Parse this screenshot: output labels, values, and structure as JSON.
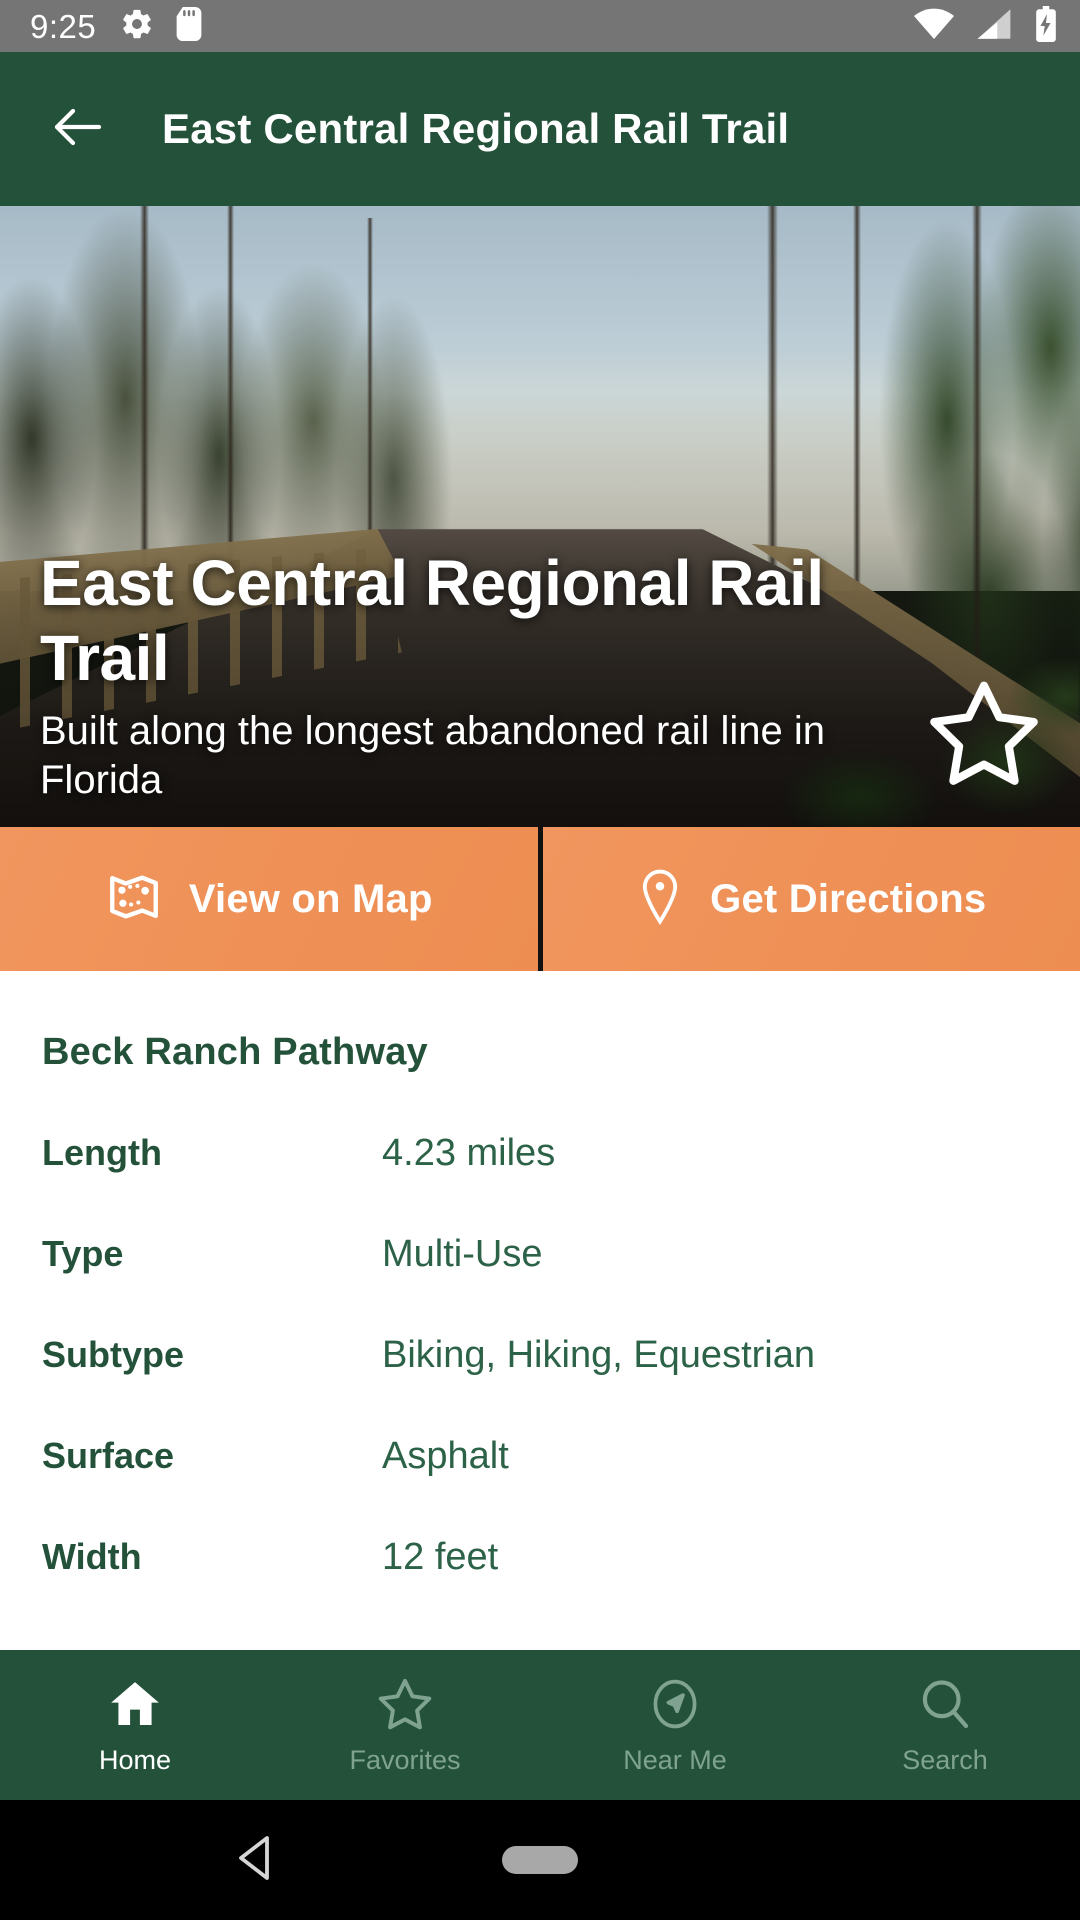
{
  "status_bar": {
    "time": "9:25",
    "left_icons": [
      "gear-icon",
      "sd-card-icon"
    ],
    "right_icons": [
      "wifi-icon",
      "cellular-signal-icon",
      "battery-charging-icon"
    ],
    "background_color": "#757575"
  },
  "app_bar": {
    "back_icon": "arrow-left-icon",
    "title": "East Central Regional Rail Trail",
    "background_color": "#235139",
    "text_color": "#ffffff"
  },
  "hero": {
    "title": "East Central Regional Rail Trail",
    "subtitle": "Built along the longest abandoned rail line in Florida",
    "favorite_icon": "star-outline-icon",
    "favorite_active": false,
    "image_description": "Wooden boardwalk trail through Florida pine forest"
  },
  "actions": {
    "background_color": "#ef9258",
    "buttons": [
      {
        "label": "View on Map",
        "icon": "map-icon"
      },
      {
        "label": "Get Directions",
        "icon": "map-pin-icon"
      }
    ]
  },
  "details": {
    "section_title": "Beck Ranch Pathway",
    "accent_color": "#235139",
    "specs": [
      {
        "key": "Length",
        "value": "4.23 miles"
      },
      {
        "key": "Type",
        "value": "Multi-Use"
      },
      {
        "key": "Subtype",
        "value": "Biking, Hiking, Equestrian"
      },
      {
        "key": "Surface",
        "value": "Asphalt"
      },
      {
        "key": "Width",
        "value": "12 feet"
      }
    ]
  },
  "bottom_nav": {
    "background_color": "#235139",
    "active_index": 0,
    "items": [
      {
        "label": "Home",
        "icon": "home-icon"
      },
      {
        "label": "Favorites",
        "icon": "star-outline-icon"
      },
      {
        "label": "Near Me",
        "icon": "navigation-compass-icon"
      },
      {
        "label": "Search",
        "icon": "magnifier-icon"
      }
    ]
  },
  "system_nav": {
    "back_icon": "triangle-back-icon",
    "home_icon": "pill-home-icon"
  }
}
